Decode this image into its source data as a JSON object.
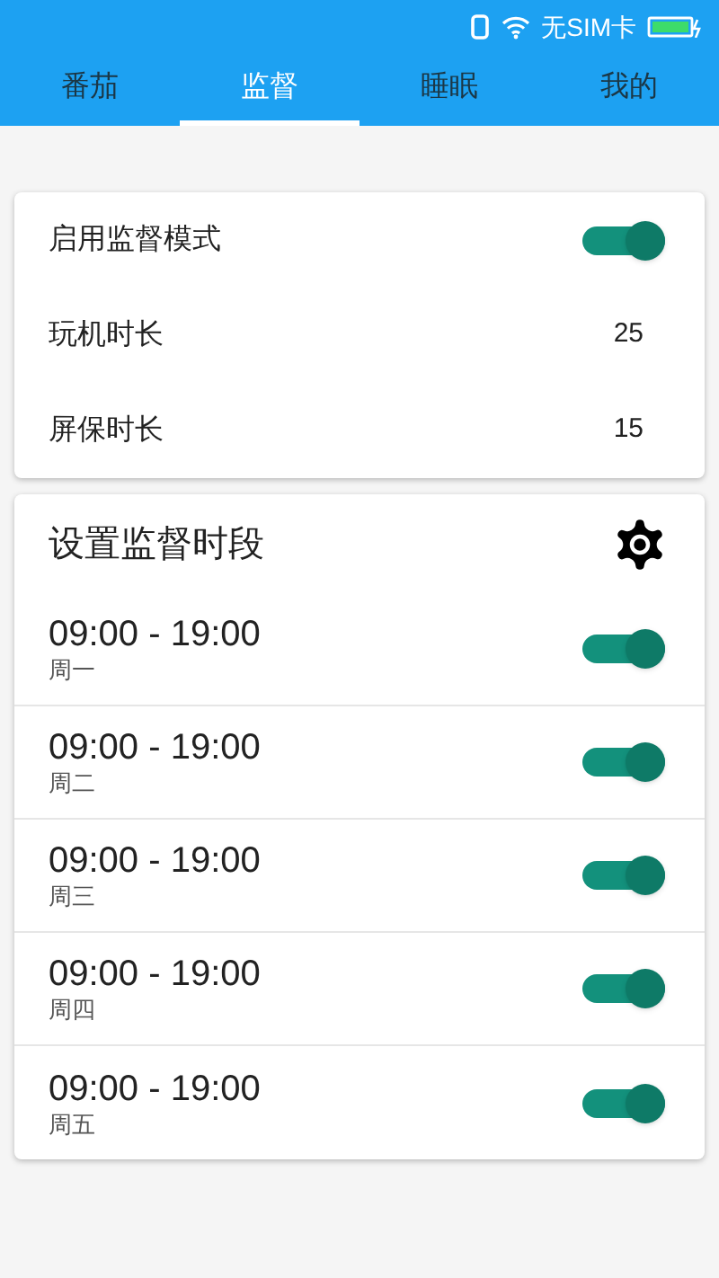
{
  "status_bar": {
    "carrier": "无SIM卡"
  },
  "tabs": [
    {
      "label": "番茄",
      "selected": false
    },
    {
      "label": "监督",
      "selected": true
    },
    {
      "label": "睡眠",
      "selected": false
    },
    {
      "label": "我的",
      "selected": false
    }
  ],
  "settings": [
    {
      "kind": "toggle",
      "label": "启用监督模式",
      "on": true
    },
    {
      "kind": "value",
      "label": "玩机时长",
      "value": "25"
    },
    {
      "kind": "value",
      "label": "屏保时长",
      "value": "15"
    }
  ],
  "periods": {
    "title": "设置监督时段",
    "items": [
      {
        "time": "09:00 - 19:00",
        "day": "周一",
        "on": true
      },
      {
        "time": "09:00 - 19:00",
        "day": "周二",
        "on": true
      },
      {
        "time": "09:00 - 19:00",
        "day": "周三",
        "on": true
      },
      {
        "time": "09:00 - 19:00",
        "day": "周四",
        "on": true
      },
      {
        "time": "09:00 - 19:00",
        "day": "周五",
        "on": true
      }
    ]
  }
}
